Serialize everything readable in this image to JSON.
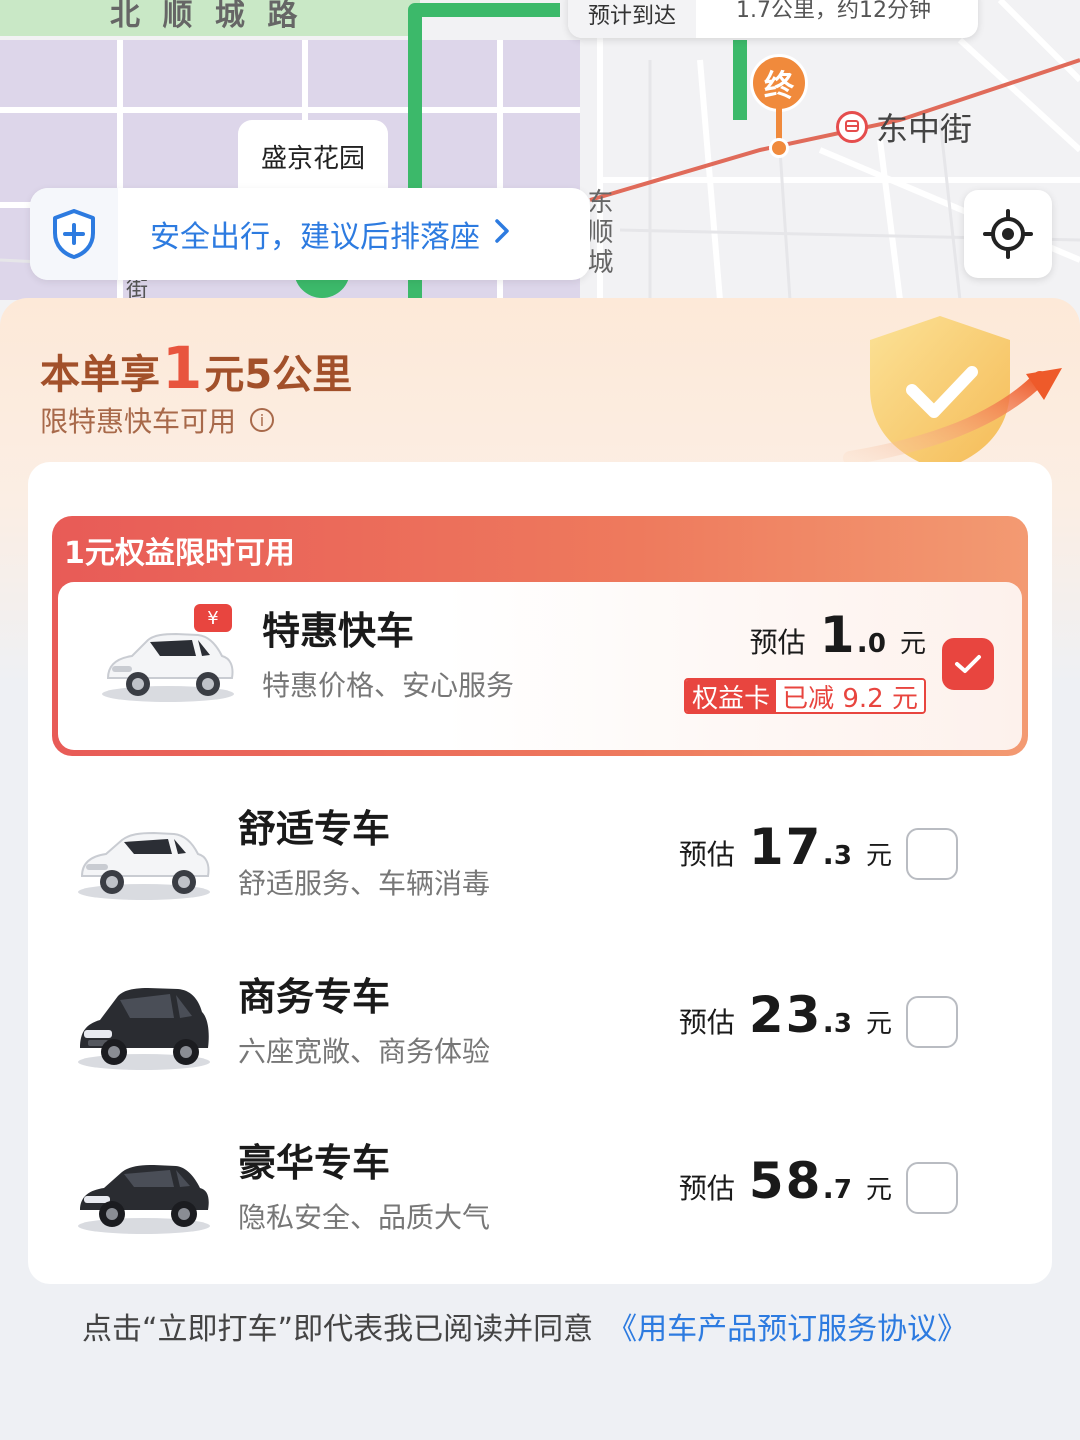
{
  "map": {
    "road_top": "北 顺 城 路",
    "road_right": "东顺城",
    "road_left": "街",
    "eta_label": "预计到达",
    "eta_value": "1.7公里，约12分钟",
    "end_pin": "终",
    "metro_station": "东中街",
    "poi": "盛京花园",
    "safety_tip": "安全出行，建议后排落座",
    "colors": {
      "route": "#3cb96a",
      "metro_line": "#e06b5a",
      "district": "#ddd6ea"
    }
  },
  "promo": {
    "title_prefix": "本单享",
    "title_highlight": "1",
    "title_suffix": "元5公里",
    "subtitle": "限特惠快车可用",
    "group_title": "1元权益限时可用"
  },
  "cars": [
    {
      "name": "特惠快车",
      "desc": "特惠价格、安心服务",
      "price_label": "预估",
      "price_int": "1",
      "price_dec": "0",
      "unit": "元",
      "checked": true,
      "discount_tag": "权益卡",
      "discount_value": "已减 9.2 元",
      "car_color": "white",
      "badge": "¥"
    },
    {
      "name": "舒适专车",
      "desc": "舒适服务、车辆消毒",
      "price_label": "预估",
      "price_int": "17",
      "price_dec": "3",
      "unit": "元",
      "checked": false,
      "car_color": "white"
    },
    {
      "name": "商务专车",
      "desc": "六座宽敞、商务体验",
      "price_label": "预估",
      "price_int": "23",
      "price_dec": "3",
      "unit": "元",
      "checked": false,
      "car_color": "black"
    },
    {
      "name": "豪华专车",
      "desc": "隐私安全、品质大气",
      "price_label": "预估",
      "price_int": "58",
      "price_dec": "7",
      "unit": "元",
      "checked": false,
      "car_color": "black"
    }
  ],
  "agreement": {
    "text": "点击“立即打车”即代表我已阅读并同意",
    "link": "《用车产品预订服务协议》"
  },
  "colors": {
    "accent": "#e8453f",
    "link": "#2d7be0",
    "promo_brown": "#a2502a"
  }
}
